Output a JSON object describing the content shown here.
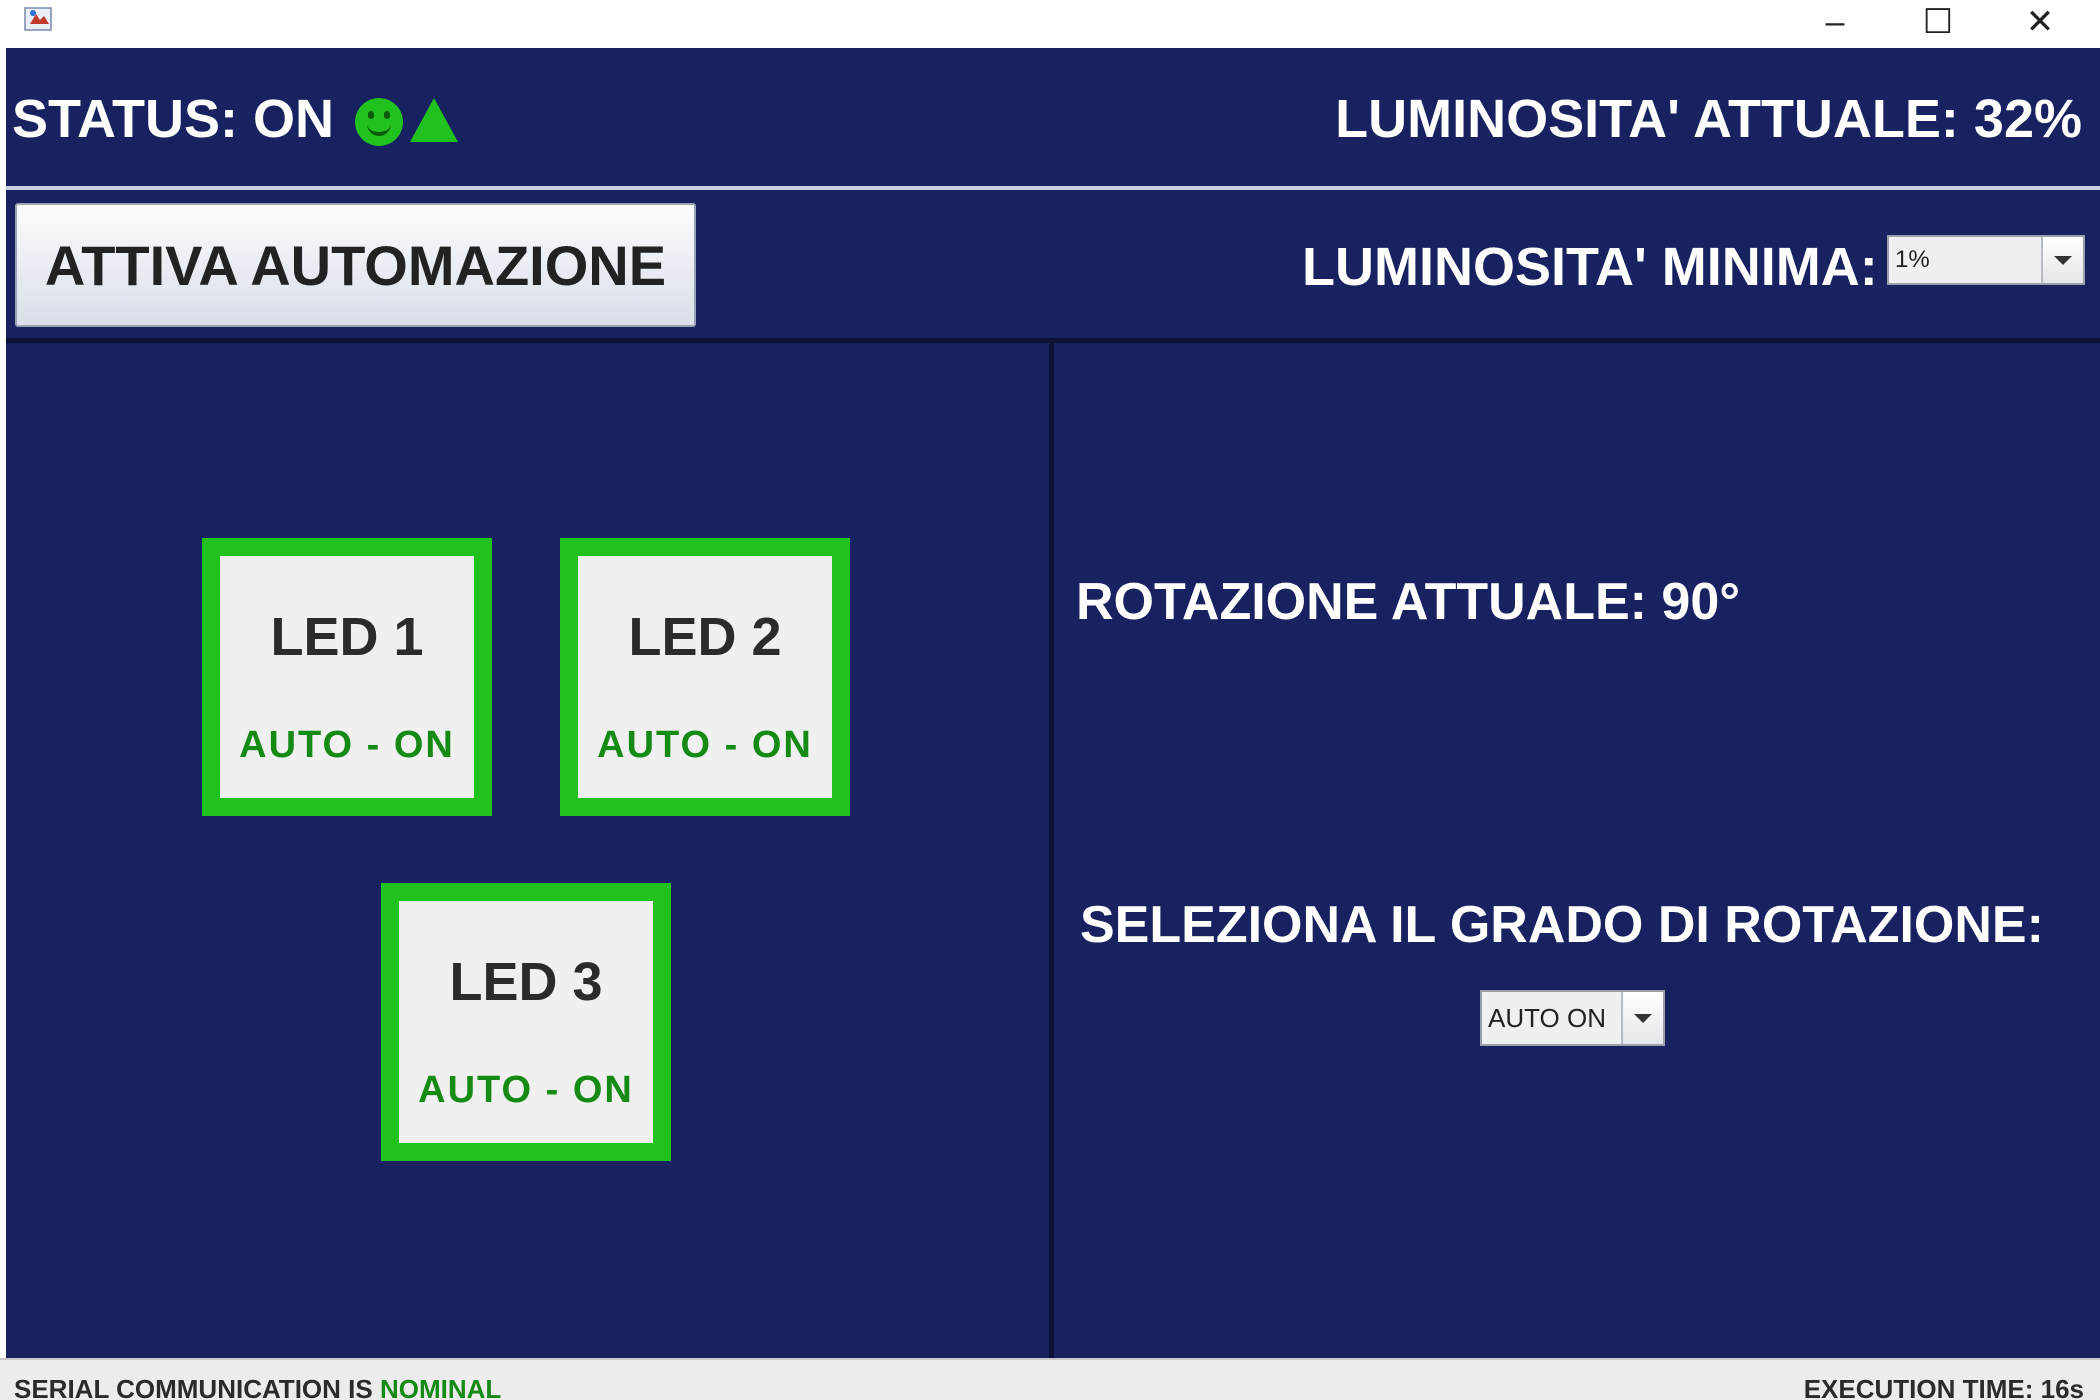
{
  "window": {
    "controls": {
      "minimize": "–",
      "maximize": "☐",
      "close": "✕"
    }
  },
  "header": {
    "status_label": "STATUS: ON",
    "status_icons": [
      "smiley-icon",
      "triangle-icon"
    ],
    "luminosity_current": "LUMINOSITA' ATTUALE: 32%"
  },
  "controls": {
    "automation_button": "ATTIVA AUTOMAZIONE",
    "luminosity_min_label": "LUMINOSITA' MINIMA:",
    "luminosity_min_value": "1%"
  },
  "leds": [
    {
      "title": "LED 1",
      "state": "AUTO - ON"
    },
    {
      "title": "LED 2",
      "state": "AUTO - ON"
    },
    {
      "title": "LED 3",
      "state": "AUTO - ON"
    }
  ],
  "rotation": {
    "current": "ROTAZIONE ATTUALE: 90°",
    "select_label": "SELEZIONA IL GRADO DI ROTAZIONE:",
    "select_value": "AUTO ON"
  },
  "statusbar": {
    "serial_prefix": "SERIAL COMMUNICATION IS",
    "serial_state": "NOMINAL",
    "execution_time": "EXECUTION TIME: 16s"
  },
  "colors": {
    "background": "#182260",
    "led_border": "#22c21e",
    "led_state_text": "#158a15"
  }
}
